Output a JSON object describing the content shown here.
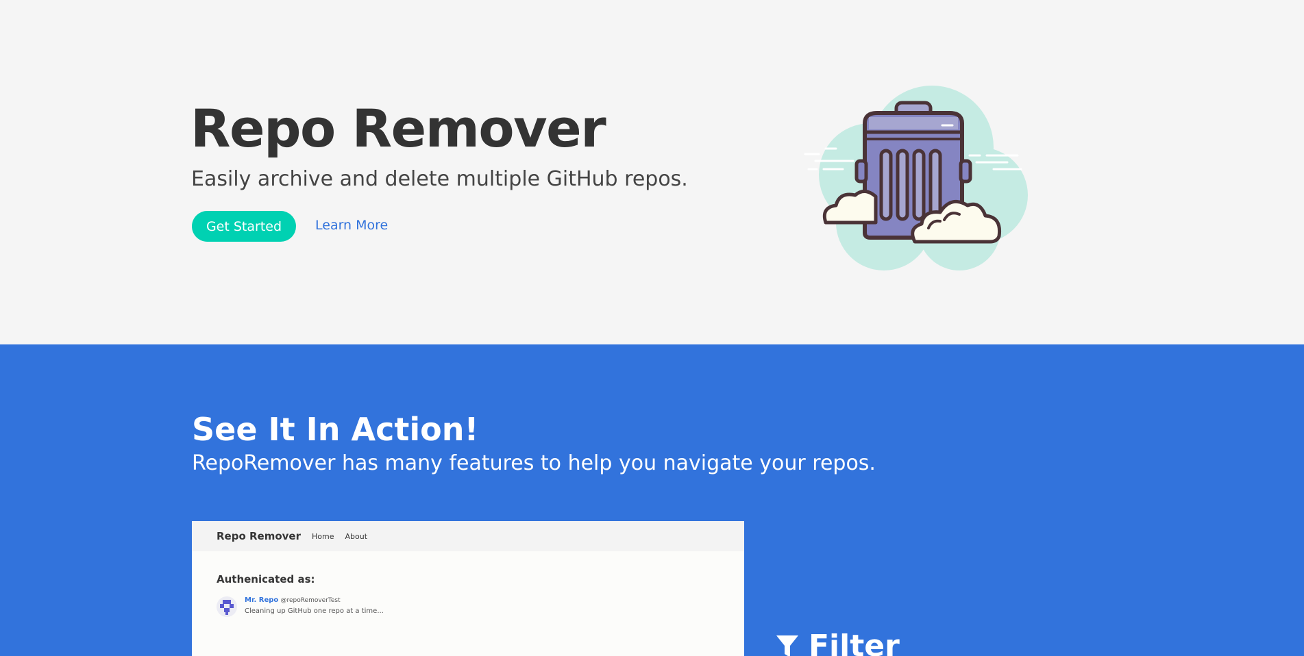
{
  "hero": {
    "title": "Repo Remover",
    "subtitle": "Easily archive and delete multiple GitHub repos.",
    "primary_button": "Get Started",
    "secondary_link": "Learn More",
    "illustration_icon": "trash-can-icon"
  },
  "action": {
    "title": "See It In Action!",
    "subtitle": "RepoRemover has many features to help you navigate your repos.",
    "preview": {
      "brand": "Repo Remover",
      "nav": [
        "Home",
        "About"
      ],
      "auth_heading": "Authenicated as:",
      "user_name": "Mr. Repo",
      "user_handle": "@repoRemoverTest",
      "user_bio": "Cleaning up GitHub one repo at a time..."
    },
    "feature": {
      "icon": "filter-icon",
      "label": "Filter"
    }
  },
  "colors": {
    "hero_bg": "#f5f5f5",
    "primary": "#00d1b2",
    "link": "#3273dc",
    "section_bg": "#3273dc",
    "text_dark": "#333333"
  }
}
